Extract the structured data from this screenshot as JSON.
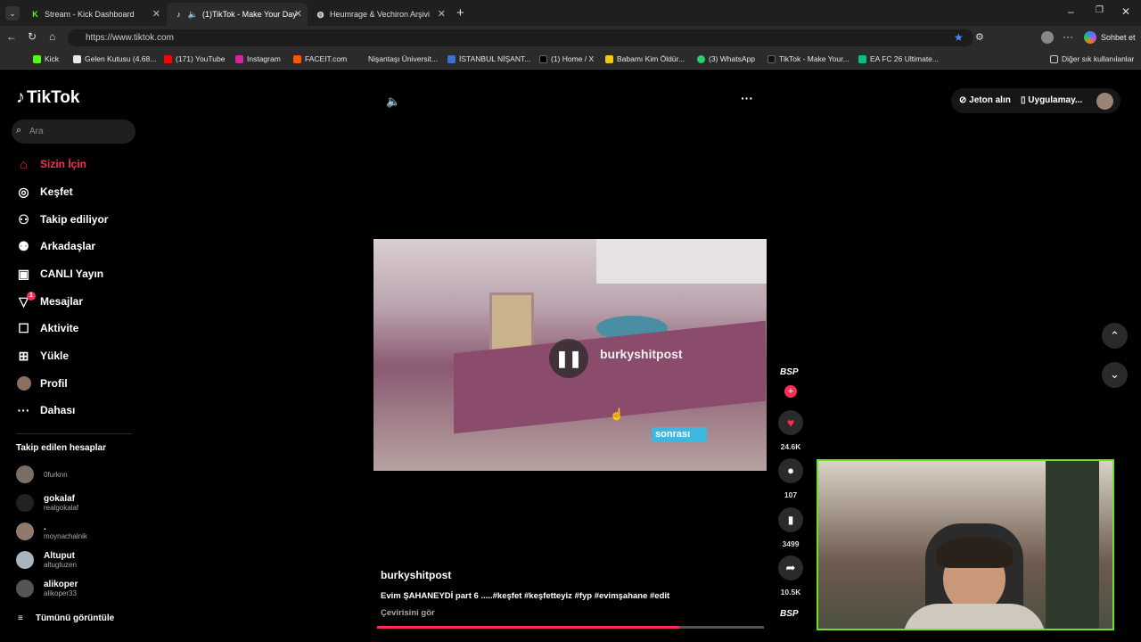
{
  "browser": {
    "tabs": [
      {
        "title": "Stream - Kick Dashboard"
      },
      {
        "title": "(1)TikTok - Make Your Day"
      },
      {
        "title": "Heumrage & Vechiron Arşivi"
      }
    ],
    "url": "https://www.tiktok.com",
    "profile_label": "Sohbet et",
    "bookmarks": [
      "Kick",
      "Gelen Kutusu (4.68...",
      "(171) YouTube",
      "Instagram",
      "FACEIT.com",
      "Nişantaşı Üniversit...",
      "İSTANBUL NİŞANT...",
      "(1) Home / X",
      "Babamı Kim Öldür...",
      "(3) WhatsApp",
      "TikTok - Make Your...",
      "EA FC 26 Ultimate..."
    ],
    "other_bookmarks": "Diğer sık kullanılanlar"
  },
  "tiktok": {
    "logo": "TikTok",
    "search_placeholder": "Ara",
    "nav": [
      {
        "label": "Sizin İçin",
        "icon": "home-icon"
      },
      {
        "label": "Keşfet",
        "icon": "compass-icon"
      },
      {
        "label": "Takip ediliyor",
        "icon": "following-icon"
      },
      {
        "label": "Arkadaşlar",
        "icon": "friends-icon"
      },
      {
        "label": "CANLI Yayın",
        "icon": "live-icon"
      },
      {
        "label": "Mesajlar",
        "icon": "messages-icon",
        "badge": "1"
      },
      {
        "label": "Aktivite",
        "icon": "activity-icon"
      },
      {
        "label": "Yükle",
        "icon": "upload-icon"
      },
      {
        "label": "Profil",
        "icon": "profile-icon"
      },
      {
        "label": "Dahası",
        "icon": "more-icon"
      }
    ],
    "following_title": "Takip edilen hesaplar",
    "following": [
      {
        "name": "",
        "handle": "0furknn"
      },
      {
        "name": "gokalaf",
        "handle": "realgokalaf"
      },
      {
        "name": ".",
        "handle": "moynachalnik"
      },
      {
        "name": "Altuput",
        "handle": "altugtuzen"
      },
      {
        "name": "alikoper",
        "handle": "alikoper33"
      }
    ],
    "see_all": "Tümünü görüntüle",
    "top_right": {
      "coins": "Jeton alın",
      "app": "Uygulamay..."
    },
    "video": {
      "watermark": "burkyshitpost",
      "caption_overlay": "sonrası",
      "author": "burkyshitpost",
      "description": "Evim ŞAHANEYDİ part 6 .....#keşfet #keşfetteyiz #fyp #evimşahane #edit",
      "translate": "Çevirisini gör",
      "progress": 0.78
    },
    "actions": {
      "likes": "24.6K",
      "comments": "107",
      "saves": "3499",
      "shares": "10.5K",
      "avatar_text": "BSP"
    }
  }
}
